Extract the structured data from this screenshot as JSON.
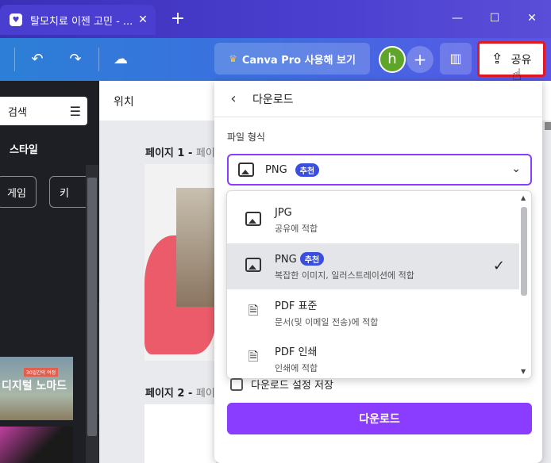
{
  "browser": {
    "tab_title": "탈모치료 이젠 고민 - ...",
    "tab_close": "✕",
    "new_tab": "+",
    "minimize": "—",
    "maximize": "☐",
    "close": "✕"
  },
  "header": {
    "pro_label": "Canva Pro 사용해 보기",
    "avatar_initial": "h",
    "share_label": "공유"
  },
  "sidebar": {
    "search_placeholder": "검색",
    "style_label": "스타일",
    "chips": [
      "게임",
      "키"
    ],
    "thumb_title": "디지털 노마드",
    "thumb_tag": "30일간의 여정"
  },
  "canvas": {
    "position_label": "위치",
    "page1_label": "페이지 1 - ",
    "page1_rest": "페이",
    "page2_label": "페이지 2 - ",
    "page2_rest": "페이"
  },
  "download_panel": {
    "title": "다운로드",
    "format_label": "파일 형식",
    "selected_format": "PNG",
    "recommended_badge": "추천",
    "options": [
      {
        "name": "JPG",
        "desc": "공유에 적합",
        "badge": "",
        "selected": false
      },
      {
        "name": "PNG",
        "desc": "복잡한 이미지, 일러스트레이션에 적합",
        "badge": "추천",
        "selected": true
      },
      {
        "name": "PDF 표준",
        "desc": "문서(및 이메일 전송)에 적합",
        "badge": "",
        "selected": false
      },
      {
        "name": "PDF 인쇄",
        "desc": "인쇄에 적합",
        "badge": "",
        "selected": false
      }
    ],
    "save_settings_label": "다운로드 설정 저장",
    "download_button": "다운로드"
  },
  "colors": {
    "accent": "#8b3dff",
    "badge": "#3a4ee0",
    "share_highlight": "#e01922"
  }
}
